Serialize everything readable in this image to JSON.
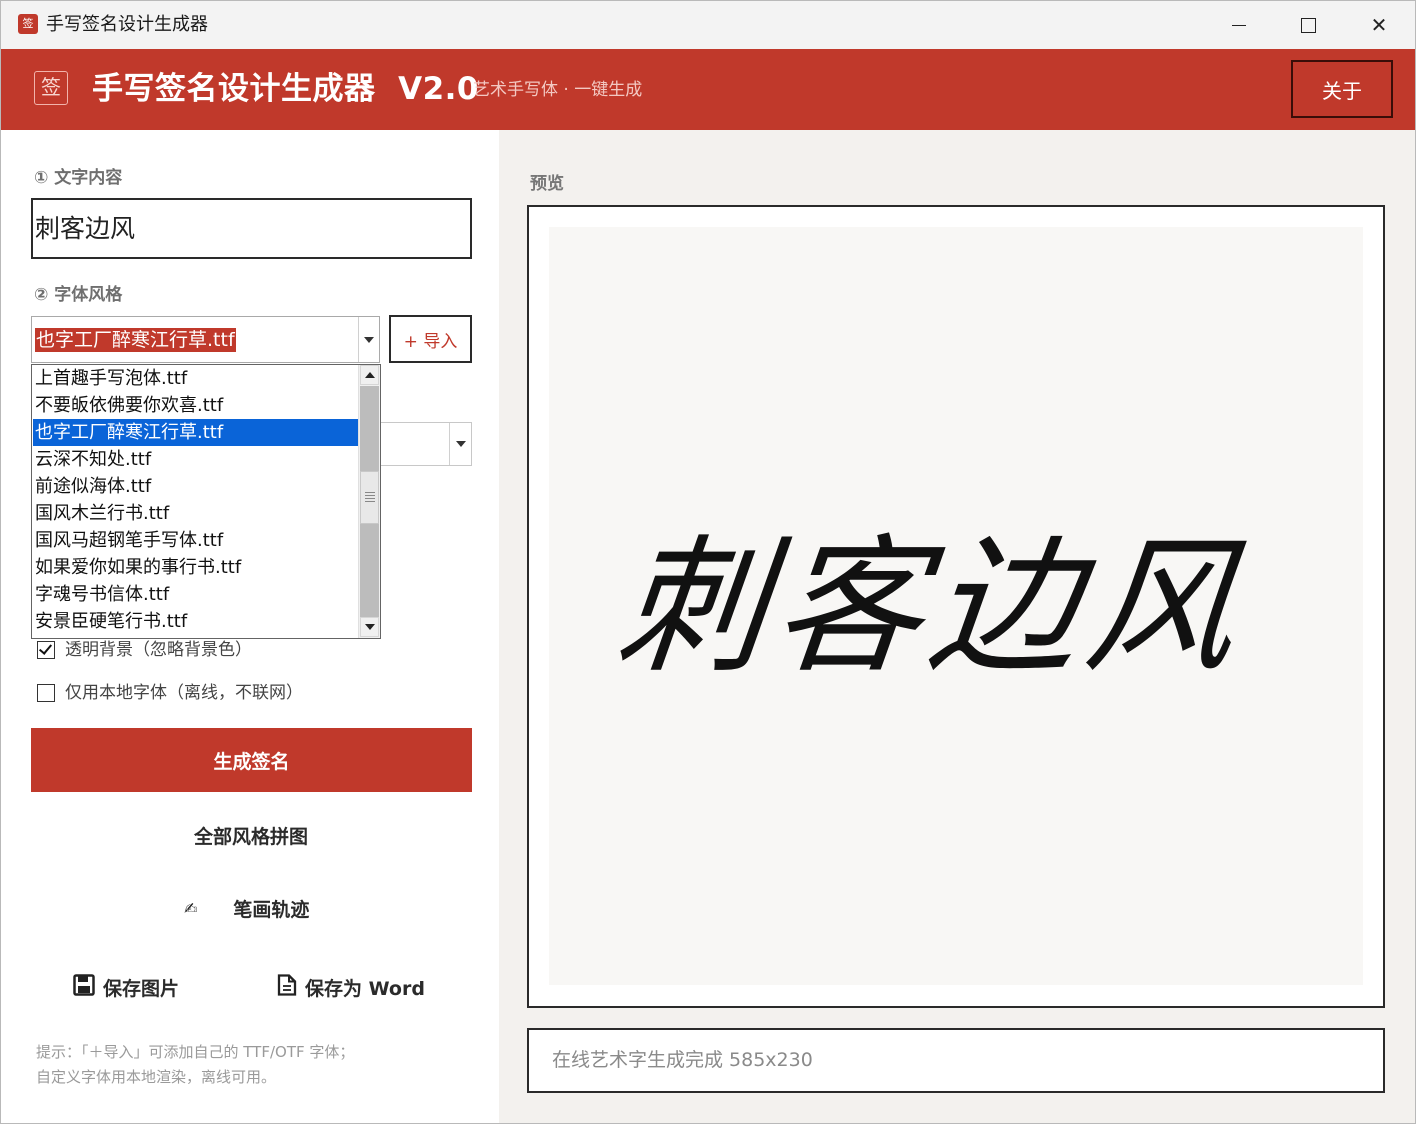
{
  "window": {
    "title": "手写签名设计生成器",
    "icon_glyph": "签",
    "controls": [
      "minimize-icon",
      "maximize-icon",
      "close-icon"
    ],
    "close_glyph": "✕"
  },
  "header": {
    "logo_glyph": "签",
    "app_name": "手写签名设计生成器  V2.0",
    "subtitle": "艺术手写体 · 一键生成",
    "about_label": "关于",
    "accent_color": "#c0392b"
  },
  "left": {
    "section1_label": "① 文字内容",
    "text_value": "刺客边风",
    "section2_label": "② 字体风格",
    "font_selected": "也字工厂醉寒江行草.ttf",
    "import_label": "+ 导入",
    "font_options": [
      "上首趣手写泡体.ttf",
      "不要皈依佛要你欢喜.ttf",
      "也字工厂醉寒江行草.ttf",
      "云深不知处.ttf",
      "前途似海体.ttf",
      "国风木兰行书.ttf",
      "国风马超钢笔手写体.ttf",
      "如果爱你如果的事行书.ttf",
      "字魂号书信体.ttf",
      "安景臣硬笔行书.ttf"
    ],
    "font_options_selected_index": 2,
    "checkbox_transparent": {
      "label": "透明背景（忽略背景色）",
      "checked": true
    },
    "checkbox_local": {
      "label": "仅用本地字体（离线，不联网）",
      "checked": false
    },
    "generate_label": "生成签名",
    "mosaic_label": "全部风格拼图",
    "stroke_icon": "✍",
    "stroke_label": "笔画轨迹",
    "save_image_icon": "floppy-disk-icon",
    "save_image_label": "保存图片",
    "save_word_icon": "document-icon",
    "save_word_label": "保存为 Word",
    "hint_line1": "提示：「＋导入」可添加自己的 TTF/OTF 字体；",
    "hint_line2": "自定义字体用本地渲染，离线可用。"
  },
  "right": {
    "preview_label": "预览",
    "signature_text": "刺客边风",
    "status_text": "在线艺术字生成完成 585x230"
  }
}
